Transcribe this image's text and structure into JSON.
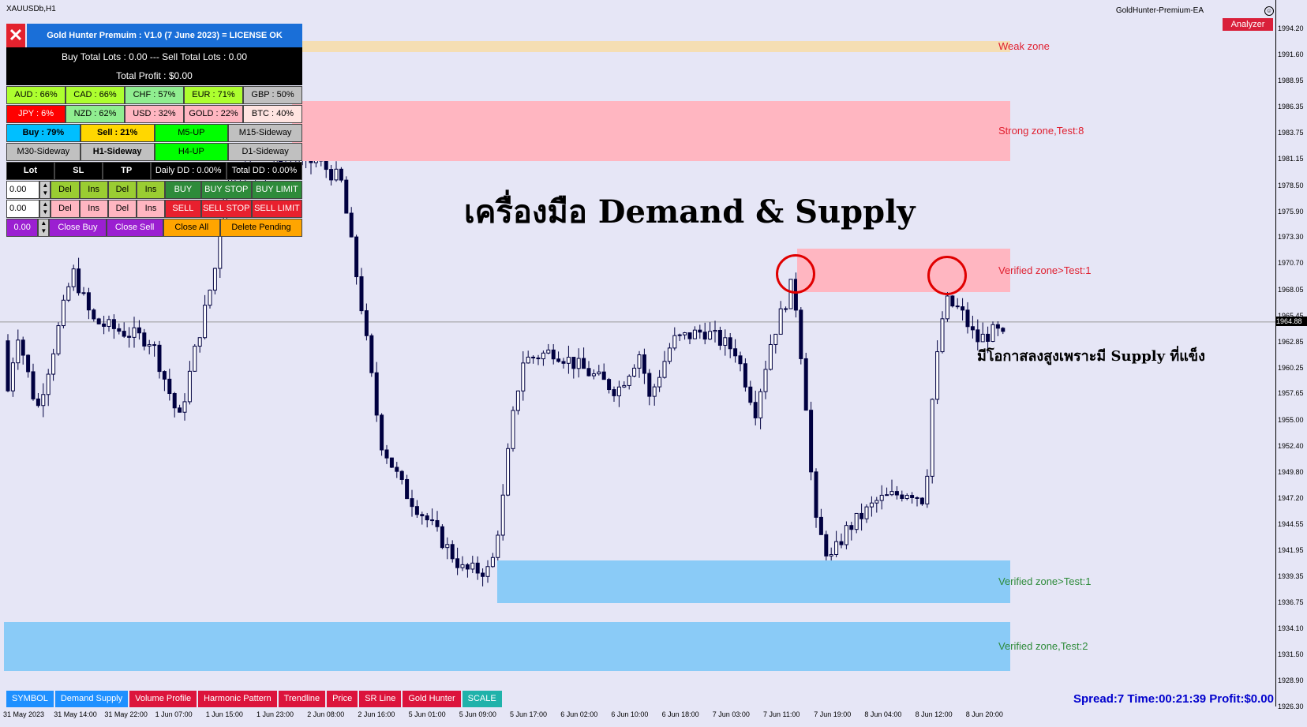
{
  "chart": {
    "symbol": "XAUUSDb,H1",
    "ea_name": "GoldHunter-Premium-EA",
    "ea_face": "☺",
    "analyzer_label": "Analyzer",
    "headline": "เครื่องมือ Demand & Supply",
    "annotation": "มีโอกาสลงสูงเพราะมี Supply ที่แข็ง",
    "current_price": "1964.88",
    "zones": [
      {
        "label": "Weak  zone",
        "color": "#f5deb3",
        "price_top": 1993.0,
        "price_bottom": 1992.0,
        "label_color": "#e02030"
      },
      {
        "label": "Strong  zone,Test:8",
        "color": "#ffb6c1",
        "price_top": 1987.0,
        "price_bottom": 1981.0,
        "label_color": "#e02030"
      },
      {
        "label": "Verified  zone>Test:1",
        "color": "#ffb6c1",
        "price_top": 1972.2,
        "price_bottom": 1967.9,
        "label_color": "#e02030"
      },
      {
        "label": "Verified  zone>Test:1",
        "color": "#8acbf7",
        "price_top": 1941.0,
        "price_bottom": 1936.7,
        "label_color": "#2e8b3a"
      },
      {
        "label": "Verified  zone,Test:2",
        "color": "#8acbf7",
        "price_top": 1934.8,
        "price_bottom": 1929.9,
        "label_color": "#2e8b3a"
      }
    ],
    "y_ticks": [
      "1994.20",
      "1991.60",
      "1988.95",
      "1986.35",
      "1983.75",
      "1981.15",
      "1978.50",
      "1975.90",
      "1973.30",
      "1970.70",
      "1968.05",
      "1965.45",
      "1962.85",
      "1960.25",
      "1957.65",
      "1955.00",
      "1952.40",
      "1949.80",
      "1947.20",
      "1944.55",
      "1941.95",
      "1939.35",
      "1936.75",
      "1934.10",
      "1931.50",
      "1928.90",
      "1926.30"
    ],
    "x_ticks": [
      "31 May 2023",
      "31 May 14:00",
      "31 May 22:00",
      "1 Jun 07:00",
      "1 Jun 15:00",
      "1 Jun 23:00",
      "2 Jun 08:00",
      "2 Jun 16:00",
      "5 Jun 01:00",
      "5 Jun 09:00",
      "5 Jun 17:00",
      "6 Jun 02:00",
      "6 Jun 10:00",
      "6 Jun 18:00",
      "7 Jun 03:00",
      "7 Jun 11:00",
      "7 Jun 19:00",
      "8 Jun 04:00",
      "8 Jun 12:00",
      "8 Jun 20:00"
    ],
    "candle_color": "#000040"
  },
  "panel": {
    "close_icon": "✕",
    "title": "Gold Hunter Premuim : V1.0 (7 June 2023) = LICENSE OK",
    "lots_line": "Buy Total Lots : 0.00 --- Sell Total Lots : 0.00",
    "profit_line": "Total Profit : $0.00",
    "currencies_row1": [
      {
        "label": "AUD : 66%",
        "color": "#adff2f"
      },
      {
        "label": "CAD : 66%",
        "color": "#adff2f"
      },
      {
        "label": "CHF : 57%",
        "color": "#90ee90"
      },
      {
        "label": "EUR : 71%",
        "color": "#adff2f"
      },
      {
        "label": "GBP : 50%",
        "color": "#c0c0c0"
      }
    ],
    "currencies_row2": [
      {
        "label": "JPY : 6%",
        "color": "#ff0000"
      },
      {
        "label": "NZD : 62%",
        "color": "#90ee90"
      },
      {
        "label": "USD : 32%",
        "color": "#ffb6c1"
      },
      {
        "label": "GOLD : 22%",
        "color": "#ffb6c1"
      },
      {
        "label": "BTC : 40%",
        "color": "#ffe4e1"
      }
    ],
    "trend_row1": [
      {
        "label": "Buy : 79%",
        "color": "#00bfff",
        "bold": true
      },
      {
        "label": "Sell : 21%",
        "color": "#ffd700",
        "bold": true
      },
      {
        "label": "M5-UP",
        "color": "#00ff00",
        "bold": false
      },
      {
        "label": "M15-Sideway",
        "color": "#c0c0c0",
        "bold": false
      }
    ],
    "trend_row2": [
      {
        "label": "M30-Sideway",
        "color": "#c0c0c0",
        "bold": false
      },
      {
        "label": "H1-Sideway",
        "color": "#c0c0c0",
        "bold": true
      },
      {
        "label": "H4-UP",
        "color": "#00ff00",
        "bold": false
      },
      {
        "label": "D1-Sideway",
        "color": "#c0c0c0",
        "bold": false
      }
    ],
    "lot_header": "Lot",
    "sl_header": "SL",
    "tp_header": "TP",
    "daily_dd": "Daily DD : 0.00%",
    "total_dd": "Total DD : 0.00%",
    "row_buy": {
      "lot": "0.00",
      "del": "Del",
      "ins": "Ins",
      "del2": "Del",
      "ins2": "Ins",
      "buy": "BUY",
      "buy_stop": "BUY STOP",
      "buy_limit": "BUY LIMIT"
    },
    "row_sell": {
      "lot": "0.00",
      "del": "Del",
      "ins": "Ins",
      "del2": "Del",
      "ins2": "Ins",
      "sell": "SELL",
      "sell_stop": "SELL STOP",
      "sell_limit": "SELL LIMIT"
    },
    "row_close": {
      "lot": "0.00",
      "close_buy": "Close Buy",
      "close_sell": "Close Sell",
      "close_all": "Close All",
      "delete_pending": "Delete Pending"
    },
    "spin_up": "▲",
    "spin_down": "▼"
  },
  "bottom_bar": {
    "buttons": [
      {
        "label": "SYMBOL",
        "color": "#1e90ff"
      },
      {
        "label": "Demand Supply",
        "color": "#1e90ff"
      },
      {
        "label": "Volume Profile",
        "color": "#dc143c"
      },
      {
        "label": "Harmonic Pattern",
        "color": "#dc143c"
      },
      {
        "label": "Trendline",
        "color": "#dc143c"
      },
      {
        "label": "Price",
        "color": "#dc143c"
      },
      {
        "label": "SR Line",
        "color": "#dc143c"
      },
      {
        "label": "Gold Hunter",
        "color": "#dc143c"
      },
      {
        "label": "SCALE",
        "color": "#20b2aa"
      }
    ],
    "status": "Spread:7 Time:00:21:39 Profit:$0.00"
  }
}
